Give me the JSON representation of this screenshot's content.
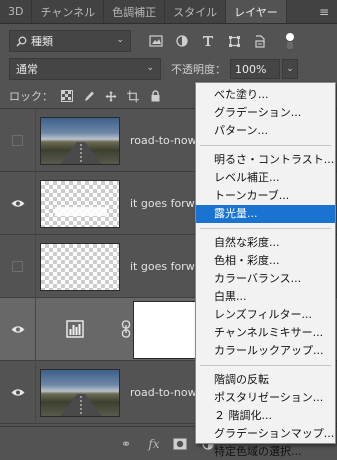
{
  "tabs": [
    {
      "label": "3D",
      "active": false
    },
    {
      "label": "チャンネル",
      "active": false
    },
    {
      "label": "色調補正",
      "active": false
    },
    {
      "label": "スタイル",
      "active": false
    },
    {
      "label": "レイヤー",
      "active": true
    }
  ],
  "filter": {
    "kind_label": "種類",
    "icons": [
      "image-filter-icon",
      "adjustment-filter-icon",
      "type-filter-icon",
      "shape-filter-icon",
      "smart-object-filter-icon",
      "filter-toggle-icon"
    ]
  },
  "blend": {
    "mode": "通常",
    "opacity_label": "不透明度：",
    "opacity_value": "100%"
  },
  "lock": {
    "label": "ロック：",
    "icons": [
      "lock-transparent-icon",
      "lock-image-icon",
      "lock-position-icon",
      "lock-artboard-icon",
      "lock-all-icon"
    ]
  },
  "layers": [
    {
      "name": "road-to-nowhere",
      "visible": false,
      "thumb": "photo"
    },
    {
      "name": "it goes forward",
      "visible": true,
      "thumb": "transparent"
    },
    {
      "name": "it goes forward",
      "visible": false,
      "thumb": "transparent"
    },
    {
      "name": "",
      "visible": true,
      "thumb": "adjustment",
      "selected": true
    },
    {
      "name": "road-to-nowhere",
      "visible": true,
      "thumb": "photo"
    }
  ],
  "menu": {
    "groups": [
      [
        "べた塗り...",
        "グラデーション...",
        "パターン..."
      ],
      [
        "明るさ・コントラスト...",
        "レベル補正...",
        "トーンカーブ...",
        "露光量..."
      ],
      [
        "自然な彩度...",
        "色相・彩度...",
        "カラーバランス...",
        "白黒...",
        "レンズフィルター...",
        "チャンネルミキサー...",
        "カラールックアップ..."
      ],
      [
        "階調の反転",
        "ポスタリゼーション...",
        "２ 階調化...",
        "グラデーションマップ...",
        "特定色域の選択..."
      ]
    ],
    "highlighted": "露光量..."
  },
  "bottom_icons": [
    "link-layers-icon",
    "fx-icon",
    "add-mask-icon",
    "new-adjustment-layer-icon"
  ],
  "colors": {
    "panel": "#535353",
    "menu_bg": "#f2f2f2",
    "highlight": "#1a73d1"
  }
}
